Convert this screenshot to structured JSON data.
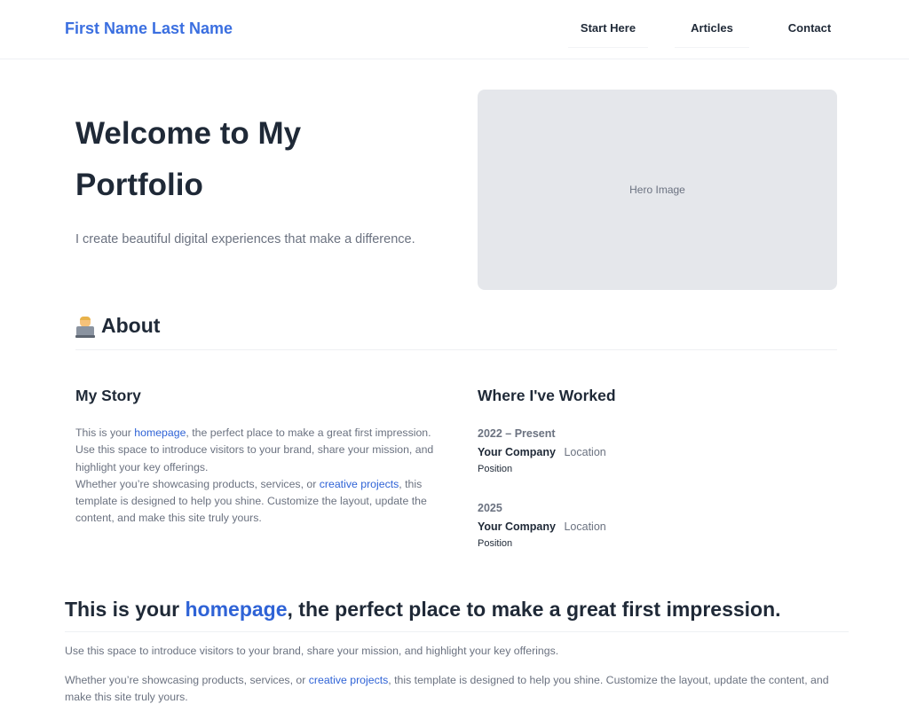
{
  "header": {
    "brand": "First Name Last Name",
    "nav": [
      {
        "label": "Start Here"
      },
      {
        "label": "Articles"
      },
      {
        "label": "Contact"
      }
    ]
  },
  "hero": {
    "title": "Welcome to My Portfolio",
    "subtitle": "I create beautiful digital experiences that make a difference.",
    "image_label": "Hero Image"
  },
  "about": {
    "heading": "About",
    "icon": "technologist-emoji",
    "story": {
      "heading": "My Story",
      "p1_before": "This is your ",
      "p1_link": "homepage",
      "p1_after": ", the perfect place to make a great first impression. Use this space to introduce visitors to your brand, share your mission, and highlight your key offerings.",
      "p2_before": "Whether you’re showcasing products, services, or ",
      "p2_link": "creative projects",
      "p2_after": ", this template is designed to help you shine. Customize the layout, update the content, and make this site truly yours."
    },
    "work": {
      "heading": "Where I've Worked",
      "jobs": [
        {
          "years": "2022 – Present",
          "company": "Your Company",
          "location": "Location",
          "position": "Position"
        },
        {
          "years": "2025",
          "company": "Your Company",
          "location": "Location",
          "position": "Position"
        }
      ]
    }
  },
  "intro": {
    "heading_before": "This is your ",
    "heading_link": "homepage",
    "heading_after": ", the perfect place to make a great first impression.",
    "p1": "Use this space to introduce visitors to your brand, share your mission, and highlight your key offerings.",
    "p2_before": "Whether you’re showcasing products, services, or ",
    "p2_link": "creative projects",
    "p2_after": ", this template is designed to help you shine. Customize the layout, update the content, and make this site truly yours."
  },
  "colors": {
    "accent": "#3b6fe0",
    "text": "#1f2937",
    "muted": "#6b7280",
    "placeholder": "#e5e7eb"
  }
}
